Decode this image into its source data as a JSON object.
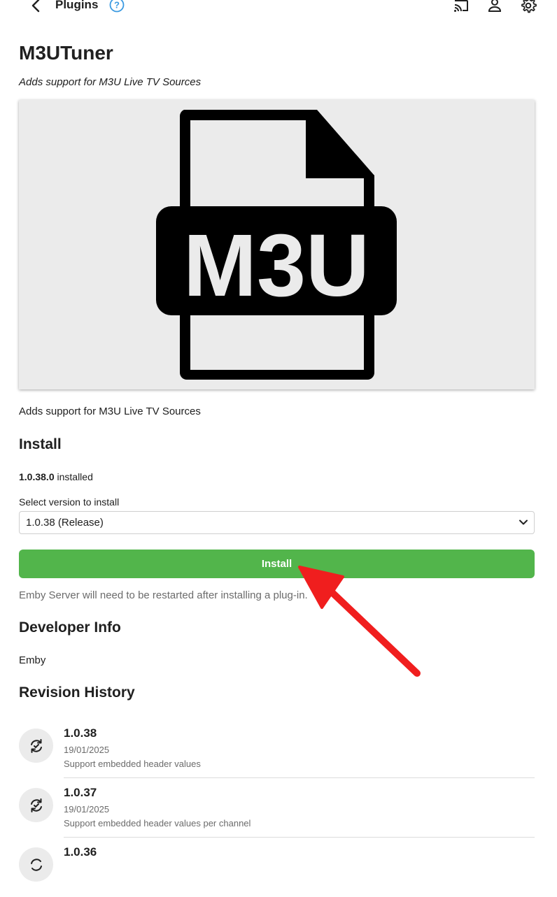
{
  "header": {
    "title": "Plugins",
    "icons": [
      "back-arrow-icon",
      "help-icon",
      "cast-icon",
      "user-icon",
      "gear-icon"
    ]
  },
  "plugin": {
    "name": "M3UTuner",
    "subtitle": "Adds support for M3U Live TV Sources",
    "image_text": "M3U",
    "description": "Adds support for M3U Live TV Sources"
  },
  "install": {
    "heading": "Install",
    "installed_version": "1.0.38.0",
    "installed_suffix": " installed",
    "select_label": "Select version to install",
    "selected_version": "1.0.38 (Release)",
    "button_label": "Install",
    "restart_note": "Emby Server will need to be restarted after installing a plug-in."
  },
  "developer": {
    "heading": "Developer Info",
    "name": "Emby"
  },
  "revisions": {
    "heading": "Revision History",
    "items": [
      {
        "version": "1.0.38",
        "date": "19/01/2025",
        "note": "Support embedded header values"
      },
      {
        "version": "1.0.37",
        "date": "19/01/2025",
        "note": "Support embedded header values per channel"
      },
      {
        "version": "1.0.36",
        "date": "",
        "note": ""
      }
    ]
  },
  "colors": {
    "install_button": "#52b54b",
    "help_icon": "#3b9ae1",
    "annotation_arrow": "#f01e1e",
    "image_background": "#ebebeb"
  }
}
